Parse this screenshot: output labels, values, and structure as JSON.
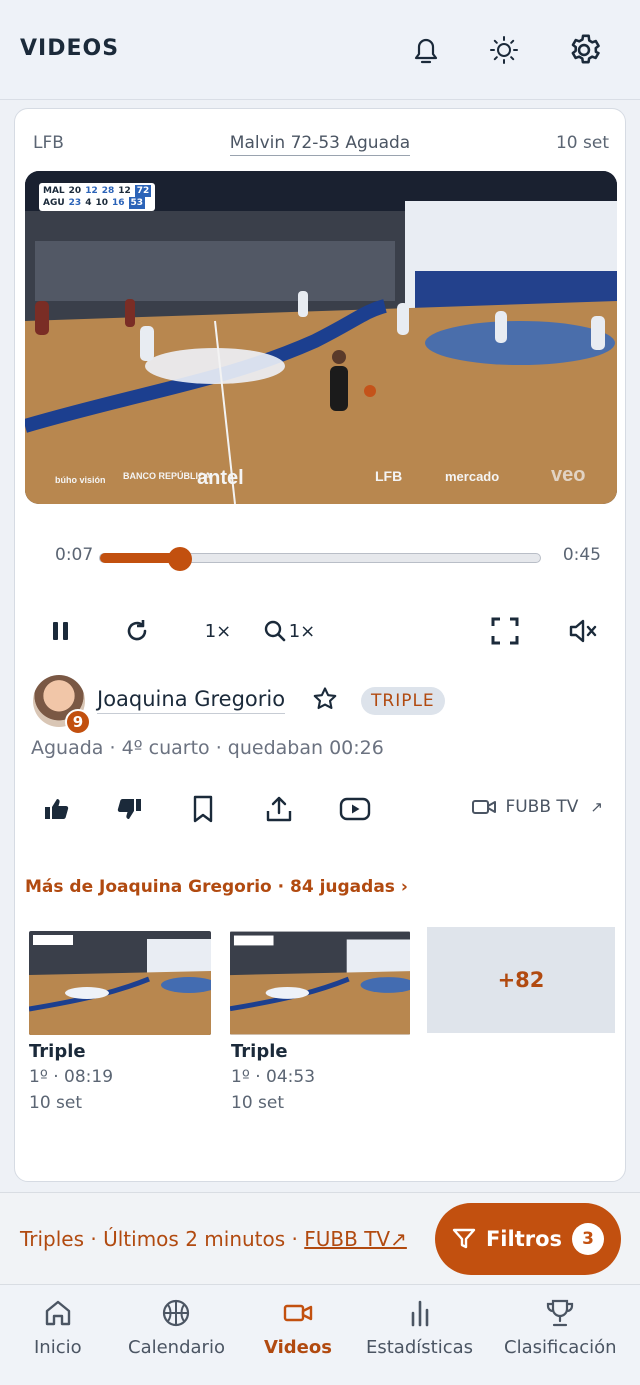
{
  "header": {
    "title": "VIDEOS"
  },
  "video": {
    "league": "LFB",
    "match": "Malvin 72-53 Aguada",
    "date": "10 set",
    "scoreboard": {
      "home": {
        "code": "MAL",
        "q": [
          "20",
          "12",
          "28",
          "12"
        ],
        "total": "72"
      },
      "away": {
        "code": "AGU",
        "q": [
          "23",
          "4",
          "10",
          "16"
        ],
        "total": "53"
      }
    },
    "sponsors": [
      "búho visión",
      "BANCO REPÚBLICA",
      "antel",
      "LFB",
      "mercado",
      "veo"
    ],
    "progress": {
      "current": "0:07",
      "duration": "0:45",
      "fraction": 0.18
    }
  },
  "controls": {
    "speed": "1×",
    "zoom": "1×"
  },
  "player": {
    "name": "Joaquina Gregorio",
    "number": "9",
    "tag": "TRIPLE",
    "context": "Aguada · 4º cuarto · quedaban 00:26"
  },
  "actions": {
    "source_label": "FUBB TV",
    "source_arrow": "↗"
  },
  "more": {
    "title": "Más de Joaquina Gregorio · 84 jugadas ›",
    "items": [
      {
        "title": "Triple",
        "time": "1º · 08:19",
        "date": "10 set"
      },
      {
        "title": "Triple",
        "time": "1º · 04:53",
        "date": "10 set"
      }
    ],
    "extra": "+82"
  },
  "filters": {
    "summary": "Triples · Últimos 2 minutos · ",
    "link": "FUBB TV↗",
    "button": "Filtros",
    "count": "3"
  },
  "nav": {
    "items": [
      {
        "label": "Inicio",
        "icon": "home-icon"
      },
      {
        "label": "Calendario",
        "icon": "basketball-icon"
      },
      {
        "label": "Videos",
        "icon": "video-icon"
      },
      {
        "label": "Estadísticas",
        "icon": "bar-chart-icon"
      },
      {
        "label": "Clasificación",
        "icon": "trophy-icon"
      }
    ],
    "active": "Videos"
  },
  "colors": {
    "accent": "#c2500f",
    "accent_text": "#b14a10",
    "court": "#b8874f",
    "court_blue": "#1c3f8f"
  }
}
